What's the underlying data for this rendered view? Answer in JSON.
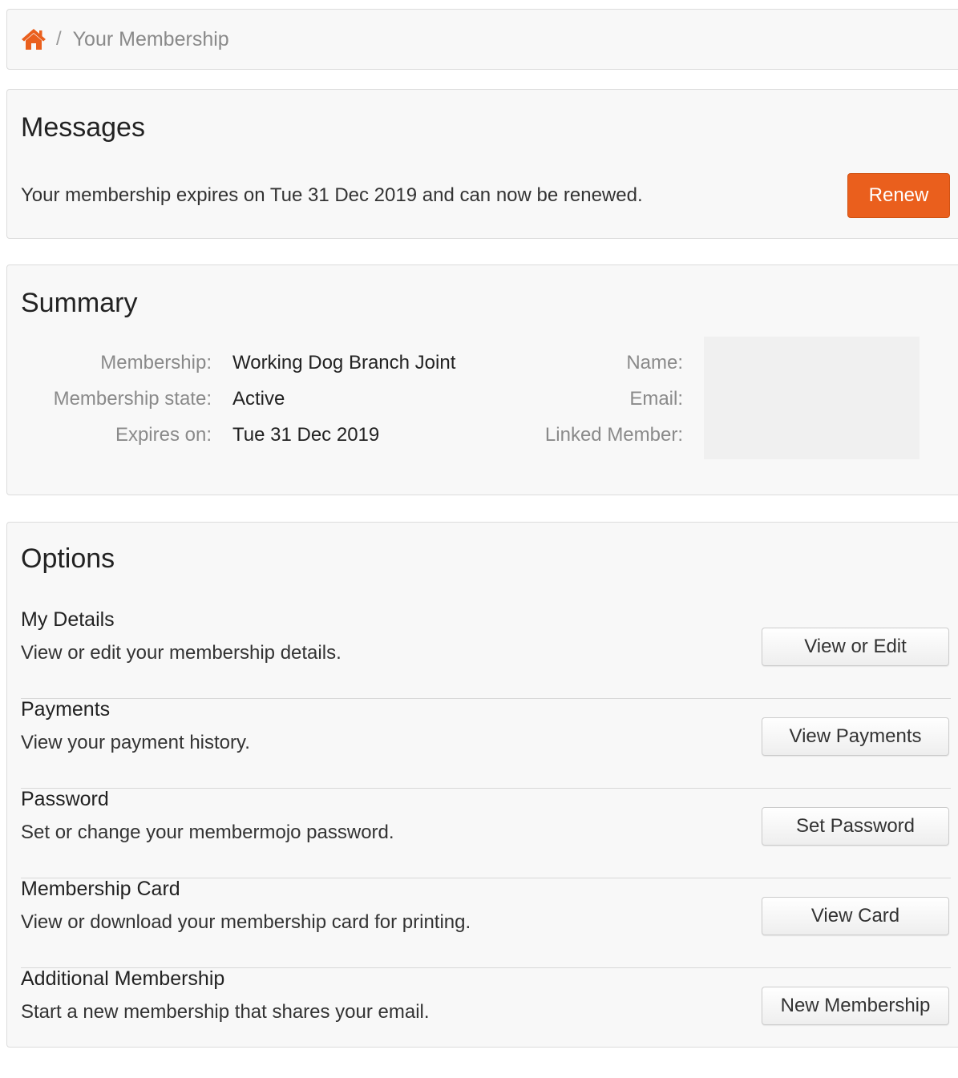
{
  "colors": {
    "accent": "#ea5f1d",
    "panel_bg": "#f8f8f8",
    "muted_text": "#8a8a8a"
  },
  "breadcrumb": {
    "home_icon": "home-icon",
    "separator": "/",
    "current": "Your Membership"
  },
  "messages": {
    "title": "Messages",
    "text": "Your membership expires on Tue 31 Dec 2019 and can now be renewed.",
    "renew_label": "Renew"
  },
  "summary": {
    "title": "Summary",
    "membership_label": "Membership:",
    "membership_value": "Working Dog Branch Joint",
    "state_label": "Membership state:",
    "state_value": "Active",
    "expires_label": "Expires on:",
    "expires_value": "Tue 31 Dec 2019",
    "name_label": "Name:",
    "email_label": "Email:",
    "linked_label": "Linked Member:"
  },
  "options": {
    "title": "Options",
    "items": [
      {
        "title": "My Details",
        "description": "View or edit your membership details.",
        "button": "View or Edit"
      },
      {
        "title": "Payments",
        "description": "View your payment history.",
        "button": "View Payments"
      },
      {
        "title": "Password",
        "description": "Set or change your membermojo password.",
        "button": "Set Password"
      },
      {
        "title": "Membership Card",
        "description": "View or download your membership card for printing.",
        "button": "View Card"
      },
      {
        "title": "Additional Membership",
        "description": "Start a new membership that shares your email.",
        "button": "New Membership"
      }
    ]
  }
}
